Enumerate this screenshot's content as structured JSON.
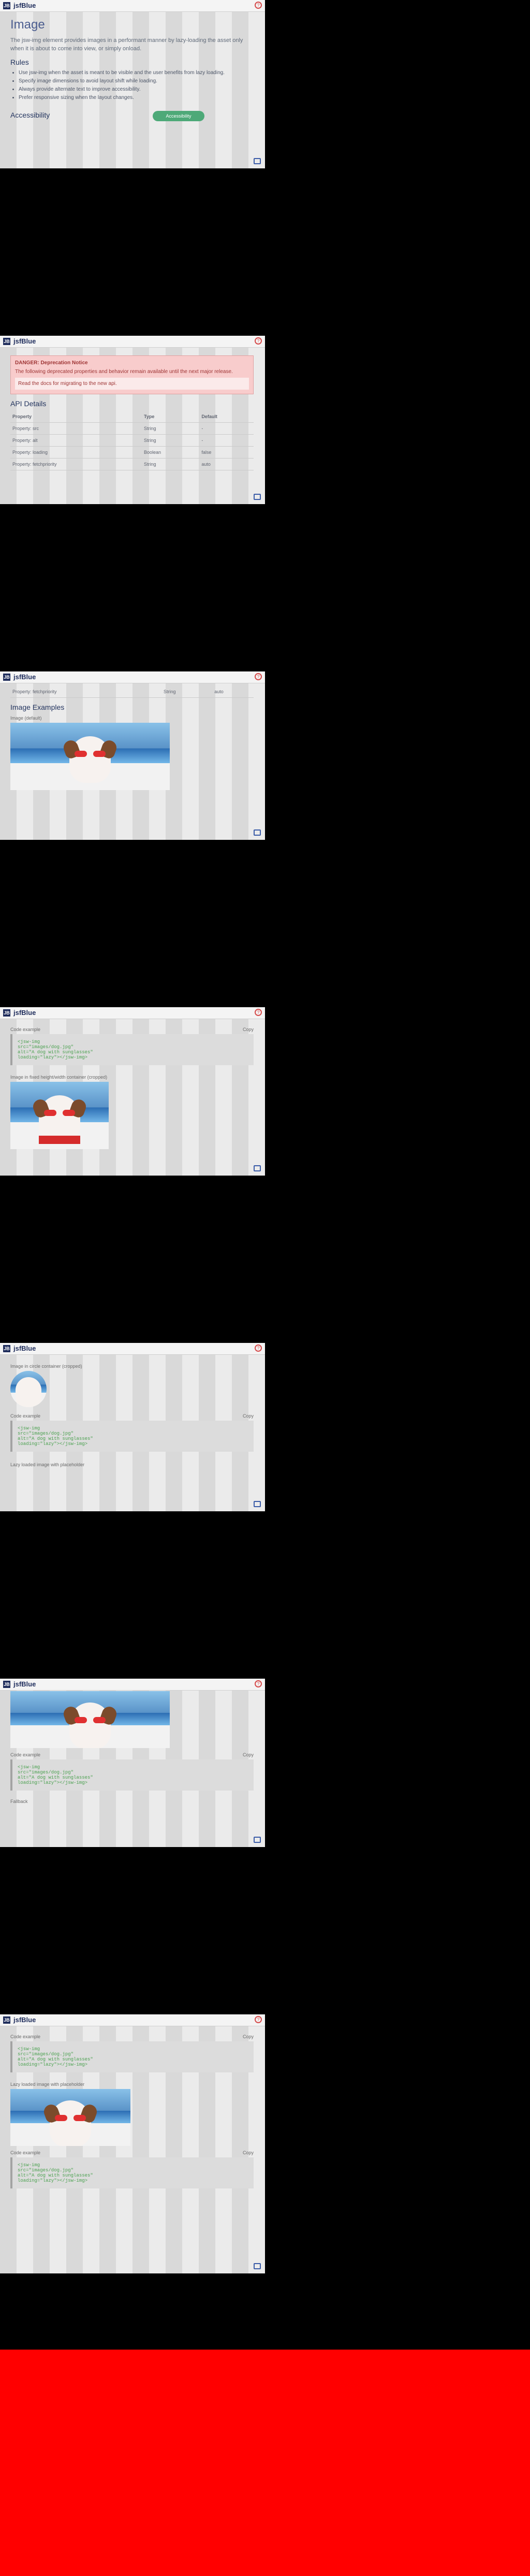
{
  "brand": {
    "logo": "JB",
    "name": "jsfBlue"
  },
  "page": {
    "title": "Image",
    "intro": "The jsw-img element provides images in a performant manner by lazy-loading the asset only when it is about to come into view, or simply onload.",
    "rules_title": "Rules",
    "rules": [
      "Use jsw-img when the asset is meant to be visible and the user benefits from lazy loading.",
      "Specify image dimensions to avoid layout shift while loading.",
      "Always provide alternate text to improve accessibility.",
      "Prefer responsive sizing when the layout changes."
    ],
    "accessibility_title": "Accessibility",
    "button_label": "Accessibility"
  },
  "deprecation": {
    "title": "DANGER: Deprecation Notice",
    "body": "The following deprecated properties and behavior remain available until the next major release.",
    "note": "Read the docs for migrating to the new api."
  },
  "api": {
    "title": "API Details",
    "headers": [
      "Property",
      "Type",
      "Default"
    ],
    "rows": [
      [
        "Property: src",
        "String",
        "-"
      ],
      [
        "Property: alt",
        "String",
        "-"
      ],
      [
        "Property: loading",
        "Boolean",
        "false"
      ],
      [
        "Property: fetchpriority",
        "String",
        "auto"
      ]
    ]
  },
  "examples": {
    "title": "Image Examples",
    "default_label": "Image (default)",
    "fixed_label": "Image in fixed height/width container (cropped)",
    "circle_label": "Image in circle container (cropped)",
    "lazy_label": "Lazy loaded image with placeholder",
    "fallback_label": "Fallback",
    "code_label": "Code example",
    "copy_label": "Copy",
    "code_snippet": "<jsw-img\n  src=\"images/dog.jpg\"\n  alt=\"A dog with sunglasses\"\n  loading=\"lazy\"></jsw-img>"
  }
}
